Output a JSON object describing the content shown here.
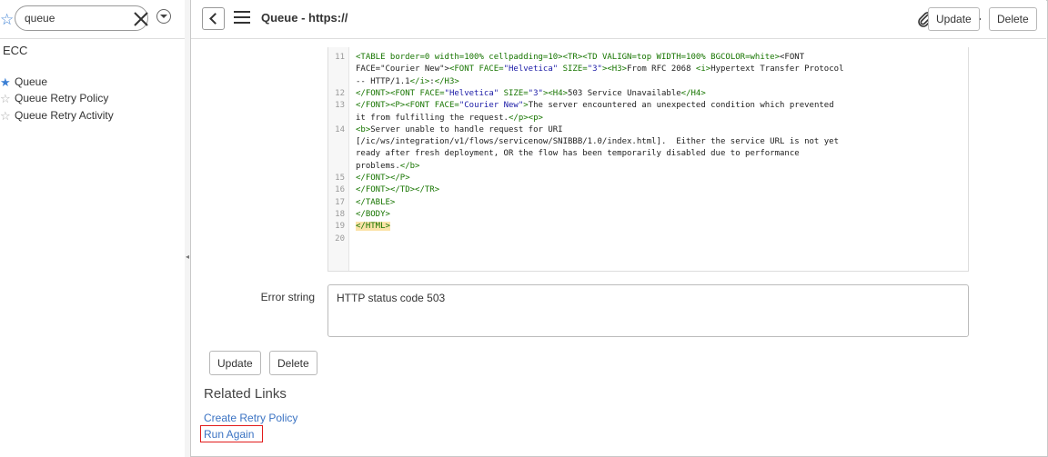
{
  "nav": {
    "filter_value": "queue",
    "app_title": "ECC",
    "items": [
      {
        "label": "Queue",
        "favorite": true
      },
      {
        "label": "Queue Retry Policy",
        "favorite": false
      },
      {
        "label": "Queue Retry Activity",
        "favorite": false
      }
    ]
  },
  "header": {
    "title": "Queue - https://",
    "update_label": "Update",
    "delete_label": "Delete"
  },
  "code": {
    "lines": [
      {
        "n": "11",
        "t": "<TABLE border=0 width=100% cellpadding=10><TR><TD VALIGN=top WIDTH=100% BGCOLOR=white><FONT"
      },
      {
        "n": "",
        "t": "FACE=\"Courier New\"><FONT FACE=\"Helvetica\" SIZE=\"3\"><H3>From RFC 2068 <i>Hypertext Transfer Protocol"
      },
      {
        "n": "",
        "t": "-- HTTP/1.1</i>:</H3>"
      },
      {
        "n": "12",
        "t": "</FONT><FONT FACE=\"Helvetica\" SIZE=\"3\"><H4>503 Service Unavailable</H4>"
      },
      {
        "n": "13",
        "t": "</FONT><P><FONT FACE=\"Courier New\">The server encountered an unexpected condition which prevented"
      },
      {
        "n": "",
        "t": "it from fulfilling the request.</p><p>"
      },
      {
        "n": "14",
        "t": "<b>Server unable to handle request for URI"
      },
      {
        "n": "",
        "t": "[/ic/ws/integration/v1/flows/servicenow/SNIBBB/1.0/index.html].  Either the service URL is not yet"
      },
      {
        "n": "",
        "t": "ready after fresh deployment, OR the flow has been temporarily disabled due to performance"
      },
      {
        "n": "",
        "t": "problems.</b>"
      },
      {
        "n": "15",
        "t": "</FONT></P>"
      },
      {
        "n": "16",
        "t": "</FONT></TD></TR>"
      },
      {
        "n": "17",
        "t": "</TABLE>"
      },
      {
        "n": "18",
        "t": "</BODY>"
      },
      {
        "n": "19",
        "t": "</HTML>"
      },
      {
        "n": "20",
        "t": ""
      }
    ]
  },
  "form": {
    "error_label": "Error string",
    "error_value": "HTTP status code 503",
    "update_label": "Update",
    "delete_label": "Delete"
  },
  "related": {
    "title": "Related Links",
    "links": [
      "Create Retry Policy",
      "Run Again"
    ]
  },
  "colors": {
    "accent": "#3b7fd4",
    "link": "#3b73c3",
    "highlight_border": "#e21b1b"
  }
}
